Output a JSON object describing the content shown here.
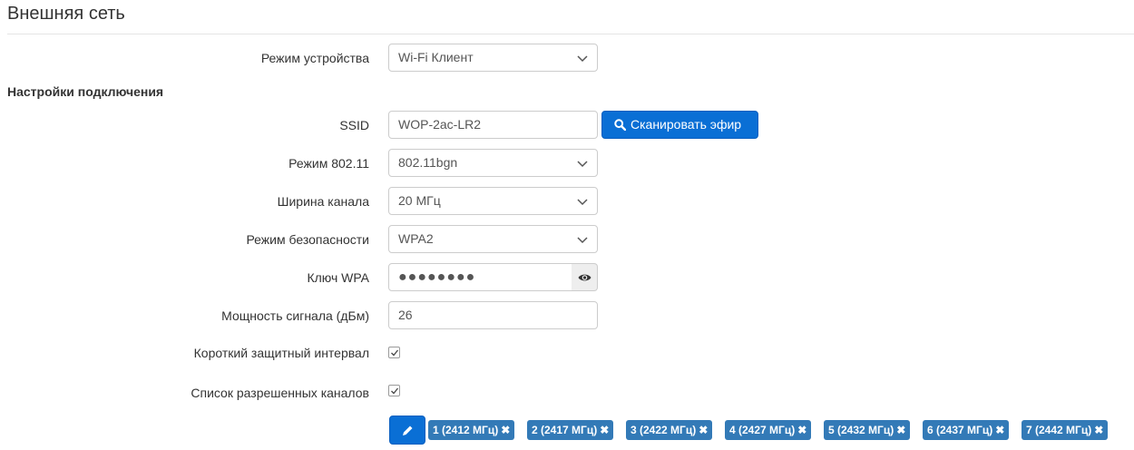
{
  "page": {
    "title": "Внешняя сеть"
  },
  "device_mode": {
    "label": "Режим устройства",
    "value": "Wi-Fi Клиент"
  },
  "connection_settings": {
    "heading": "Настройки подключения",
    "ssid": {
      "label": "SSID",
      "value": "WOP-2ac-LR2"
    },
    "scan_button": {
      "label": "Сканировать эфир",
      "icon": "search-icon"
    },
    "mode_80211": {
      "label": "Режим 802.11",
      "value": "802.11bgn"
    },
    "channel_width": {
      "label": "Ширина канала",
      "value": "20 МГц"
    },
    "security_mode": {
      "label": "Режим безопасности",
      "value": "WPA2"
    },
    "wpa_key": {
      "label": "Ключ WPA",
      "value": "●●●●●●●●",
      "toggle_icon": "eye-icon"
    },
    "signal_power": {
      "label": "Мощность сигнала (дБм)",
      "value": "26"
    },
    "short_guard_interval": {
      "label": "Короткий защитный интервал",
      "checked": true
    },
    "allowed_channels": {
      "label": "Список разрешенных каналов",
      "checked": true,
      "edit_icon": "pencil-icon",
      "channels": [
        {
          "label": "1 (2412 МГц)"
        },
        {
          "label": "2 (2417 МГц)"
        },
        {
          "label": "3 (2422 МГц)"
        },
        {
          "label": "4 (2427 МГц)"
        },
        {
          "label": "5 (2432 МГц)"
        },
        {
          "label": "6 (2437 МГц)"
        },
        {
          "label": "7 (2442 МГц)"
        }
      ],
      "remove_glyph": "✖"
    }
  },
  "colors": {
    "primary_button": "#0a6fd5",
    "chip": "#337ab7"
  }
}
